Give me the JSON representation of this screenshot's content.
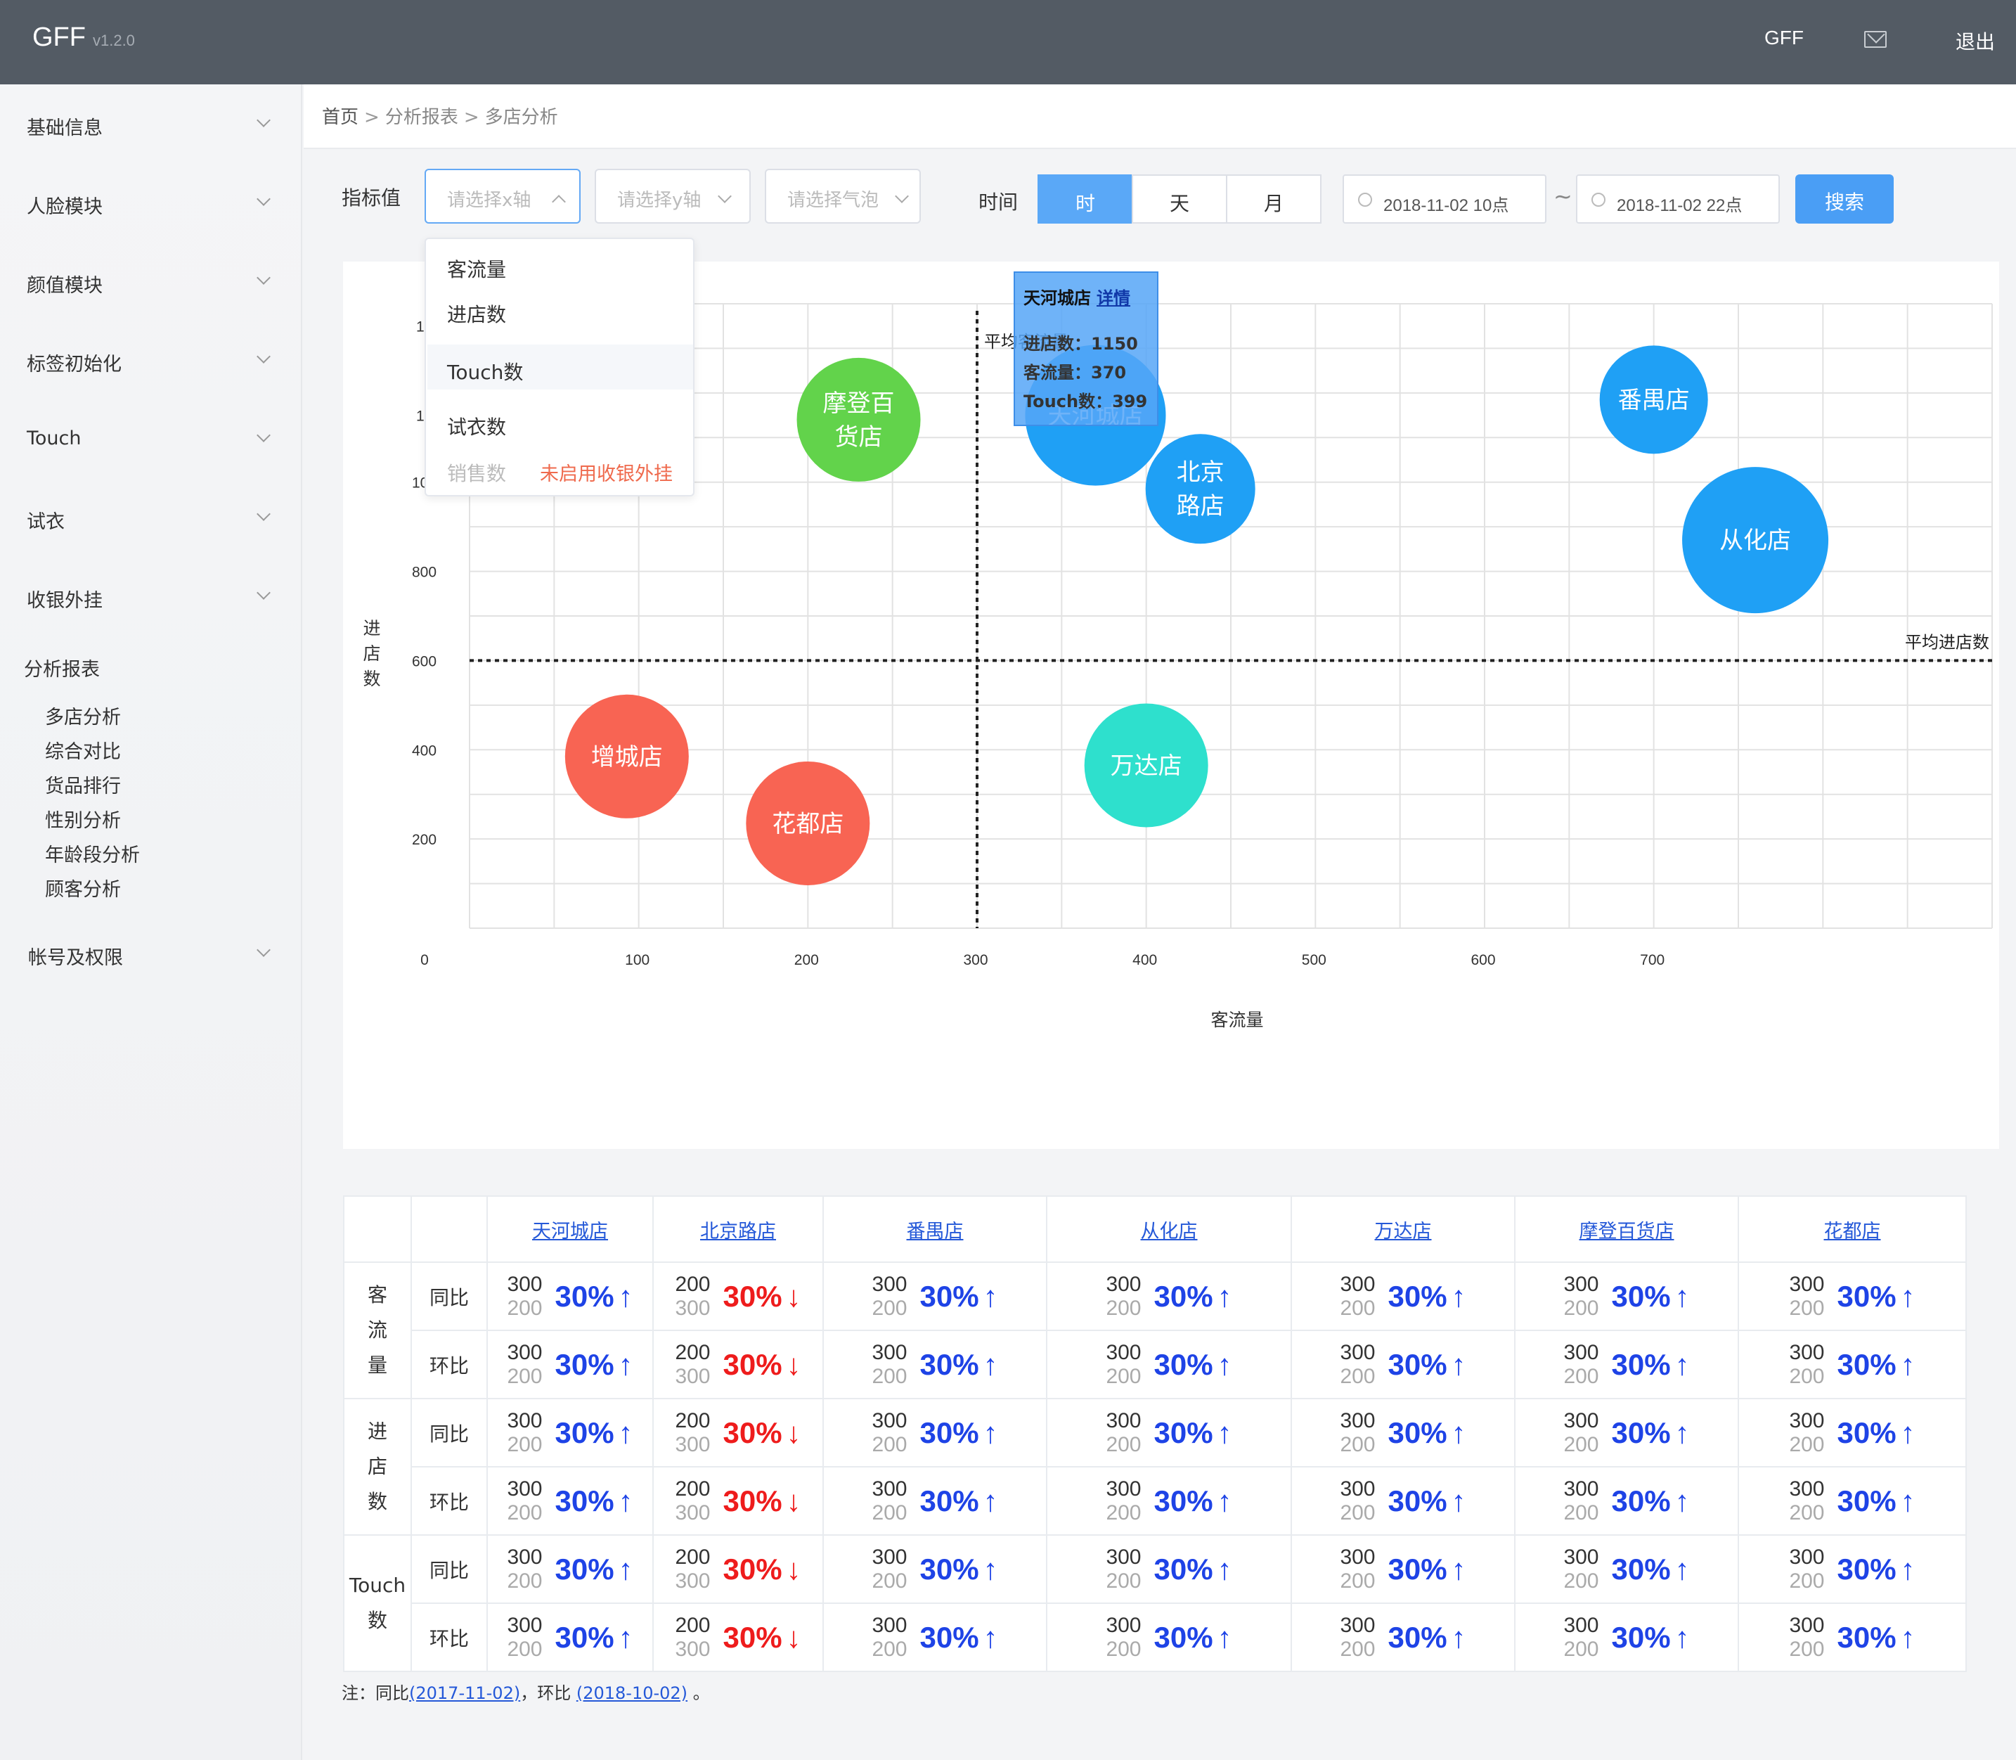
{
  "header": {
    "brand": "GFF",
    "version": "v1.2.0",
    "user": "GFF",
    "mail_icon": "mail-icon",
    "logout": "退出"
  },
  "sidebar": {
    "items": [
      {
        "label": "基础信息"
      },
      {
        "label": "人脸模块"
      },
      {
        "label": "颜值模块"
      },
      {
        "label": "标签初始化"
      },
      {
        "label": "Touch"
      },
      {
        "label": "试衣"
      },
      {
        "label": "收银外挂"
      }
    ],
    "open_group": {
      "label": "分析报表",
      "children": [
        "多店分析",
        "综合对比",
        "货品排行",
        "性别分析",
        "年龄段分析",
        "顾客分析"
      ]
    },
    "last_item": {
      "label": "帐号及权限"
    }
  },
  "breadcrumb": {
    "home": "首页",
    "sep": ">",
    "parent": "分析报表",
    "current": "多店分析"
  },
  "filters": {
    "metric_label": "指标值",
    "x_placeholder": "请选择x轴",
    "y_placeholder": "请选择y轴",
    "bubble_placeholder": "请选择气泡",
    "time_label": "时间",
    "segments": [
      "时",
      "天",
      "月"
    ],
    "active_segment": "时",
    "date_start": "2018-11-02 10点",
    "tilde": "~",
    "date_end": "2018-11-02 22点",
    "search": "搜索"
  },
  "dropdown": {
    "options": [
      "客流量",
      "进店数",
      "Touch数",
      "试衣数"
    ],
    "highlighted": "Touch数",
    "disabled_option": "销售数",
    "disabled_note": "未启用收银外挂"
  },
  "tooltip": {
    "store": "天河城店",
    "link": "详情",
    "lines": [
      "进店数：1150",
      "客流量：370",
      "Touch数：399"
    ]
  },
  "chart_data": {
    "type": "scatter",
    "xlabel": "客流量",
    "ylabel": "进店数",
    "x_ticks": [
      "0",
      "100",
      "200",
      "300",
      "400",
      "500",
      "600",
      "700"
    ],
    "y_ticks": [
      "200",
      "400",
      "600",
      "800",
      "1000",
      "12",
      "14"
    ],
    "xlim": [
      0,
      900
    ],
    "ylim": [
      0,
      1400
    ],
    "avg_x": {
      "value": 300,
      "label": "平均客流量"
    },
    "avg_y": {
      "value": 600,
      "label": "平均进店数"
    },
    "grid": true,
    "points": [
      {
        "name": "天河城店",
        "label_lines": [
          "天河城店"
        ],
        "x": 370,
        "y": 1150,
        "r": 100,
        "color": "#1fa0f5"
      },
      {
        "name": "北京路店",
        "label_lines": [
          "北京",
          "路店"
        ],
        "x": 432,
        "y": 985,
        "r": 78,
        "color": "#1fa0f5"
      },
      {
        "name": "番禺店",
        "label_lines": [
          "番禺店"
        ],
        "x": 700,
        "y": 1185,
        "r": 77,
        "color": "#1fa0f5"
      },
      {
        "name": "从化店",
        "label_lines": [
          "从化店"
        ],
        "x": 760,
        "y": 870,
        "r": 104,
        "color": "#1fa0f5"
      },
      {
        "name": "摩登百货店",
        "label_lines": [
          "摩登百",
          "货店"
        ],
        "x": 230,
        "y": 1140,
        "r": 88,
        "color": "#62d34b"
      },
      {
        "name": "万达店",
        "label_lines": [
          "万达店"
        ],
        "x": 400,
        "y": 365,
        "r": 88,
        "color": "#2ee0cd"
      },
      {
        "name": "增城店",
        "label_lines": [
          "增城店"
        ],
        "x": 93,
        "y": 385,
        "r": 88,
        "color": "#f86453"
      },
      {
        "name": "花都店",
        "label_lines": [
          "花都店"
        ],
        "x": 200,
        "y": 235,
        "r": 88,
        "color": "#f86453"
      }
    ]
  },
  "table": {
    "stores": [
      "天河城店",
      "北京路店",
      "番禺店",
      "从化店",
      "万达店",
      "摩登百货店",
      "花都店"
    ],
    "groups": [
      {
        "name_lines": [
          "客",
          "流",
          "量"
        ],
        "rows": [
          "同比",
          "环比"
        ]
      },
      {
        "name_lines": [
          "进",
          "店",
          "数"
        ],
        "rows": [
          "同比",
          "环比"
        ]
      },
      {
        "name_lines": [
          "Touch",
          "数"
        ],
        "rows": [
          "同比",
          "环比"
        ]
      }
    ],
    "cells_up": {
      "a": "300",
      "b": "200",
      "pct": "30%",
      "arrow": "↑"
    },
    "cells_down": {
      "a": "200",
      "b": "300",
      "pct": "30%",
      "arrow": "↓"
    },
    "down_store_index": 1
  },
  "note": {
    "prefix": "注：同比",
    "yoy": "(2017-11-02)",
    "mid": "，环比",
    "mom": "(2018-10-02)",
    "suffix": "。"
  }
}
